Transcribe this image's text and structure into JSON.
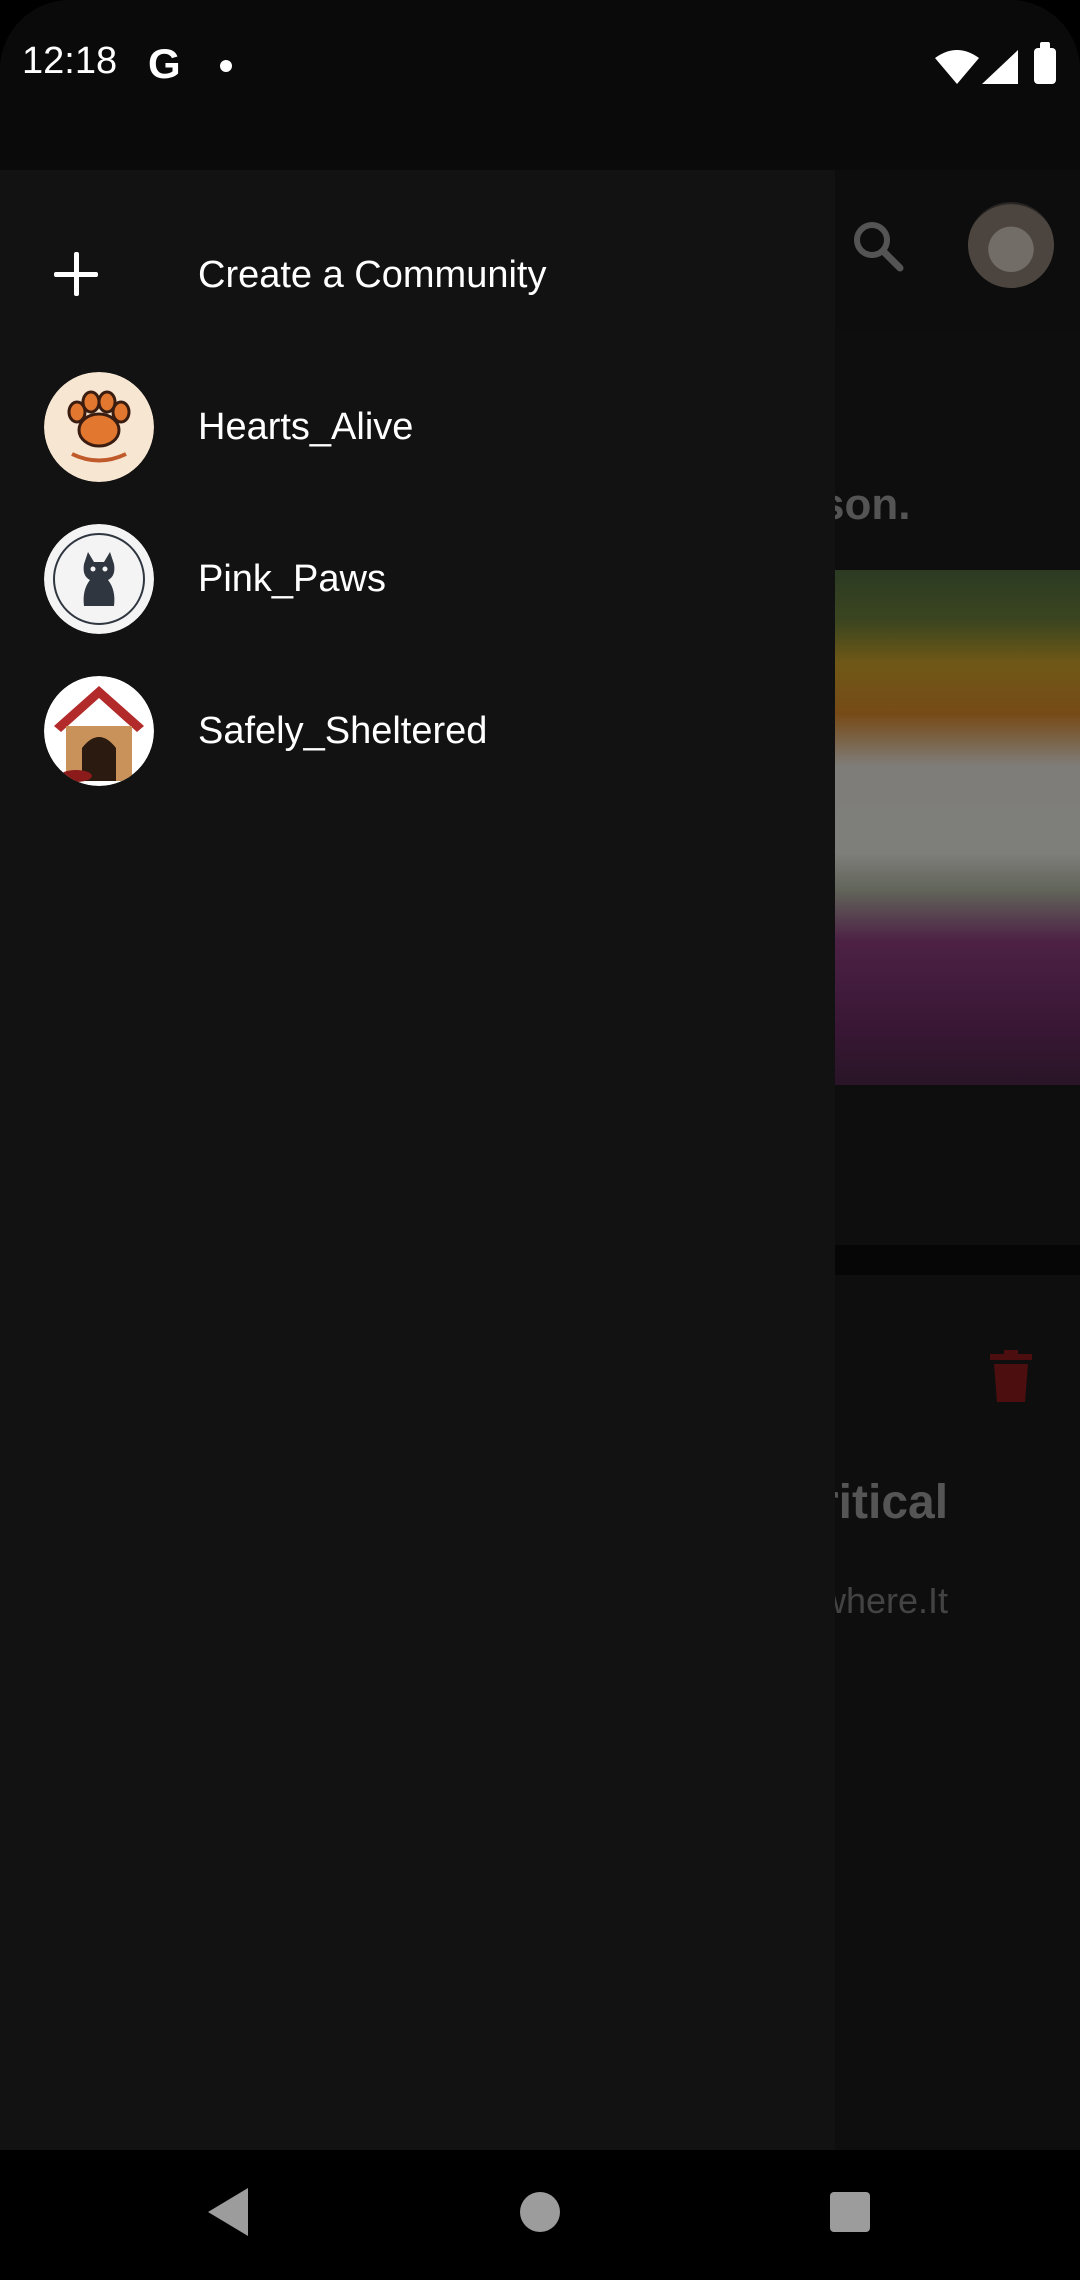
{
  "status_bar": {
    "time": "12:18",
    "g_label": "G"
  },
  "background_screen": {
    "post_title_fragment": "son.",
    "card_title_fragment": "ritical",
    "card_text_fragment": "where.It"
  },
  "drawer": {
    "create_label": "Create a Community",
    "communities": [
      {
        "name": "Hearts_Alive",
        "icon": "paw-logo"
      },
      {
        "name": "Pink_Paws",
        "icon": "cat-logo"
      },
      {
        "name": "Safely_Sheltered",
        "icon": "doghouse-logo"
      }
    ]
  },
  "colors": {
    "drawer_bg": "#121212",
    "delete_icon": "#8b1a1a",
    "paw_orange": "#e2782f"
  }
}
